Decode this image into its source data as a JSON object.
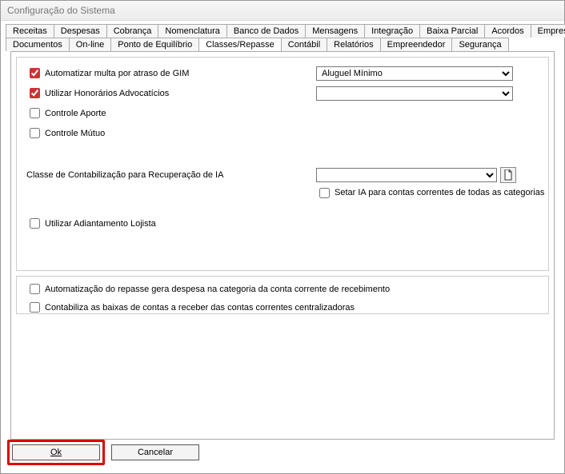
{
  "window": {
    "title": "Configuração do Sistema"
  },
  "tabs_row1": [
    "Receitas",
    "Despesas",
    "Cobrança",
    "Nomenclatura",
    "Banco de Dados",
    "Mensagens",
    "Integração",
    "Baixa Parcial",
    "Acordos",
    "Empresa"
  ],
  "tabs_row2": [
    "Documentos",
    "On-line",
    "Ponto de Equilíbrio",
    "Classes/Repasse",
    "Contábil",
    "Relatórios",
    "Empreendedor",
    "Segurança"
  ],
  "active_tab": "Classes/Repasse",
  "panel1": {
    "chk_auto_multas": {
      "label": "Automatizar multa por atraso de GIM",
      "checked": true
    },
    "chk_honorarios": {
      "label": "Utilizar Honorários Advocatícios",
      "checked": true
    },
    "chk_controle_aporte": {
      "label": "Controle Aporte",
      "checked": false
    },
    "chk_controle_mutuo": {
      "label": "Controle Mútuo",
      "checked": false
    },
    "sel_aluguel": {
      "value": "Aluguel Mínimo"
    },
    "sel_honorarios": {
      "value": ""
    },
    "lbl_classe_ia": "Classe de Contabilização para Recuperação de IA",
    "sel_classe_ia": {
      "value": ""
    },
    "chk_setar_ia": {
      "label": "Setar IA para contas correntes de todas as categorias",
      "checked": false
    },
    "chk_adiantamento": {
      "label": "Utilizar Adiantamento Lojista",
      "checked": false
    }
  },
  "panel2": {
    "chk_auto_repasse": {
      "label": "Automatização do repasse gera despesa na categoria da conta corrente de recebimento",
      "checked": false
    },
    "chk_contabiliza": {
      "label": "Contabiliza as baixas de contas a receber das contas correntes centralizadoras",
      "checked": false
    }
  },
  "buttons": {
    "ok": "Ok",
    "cancel": "Cancelar"
  }
}
